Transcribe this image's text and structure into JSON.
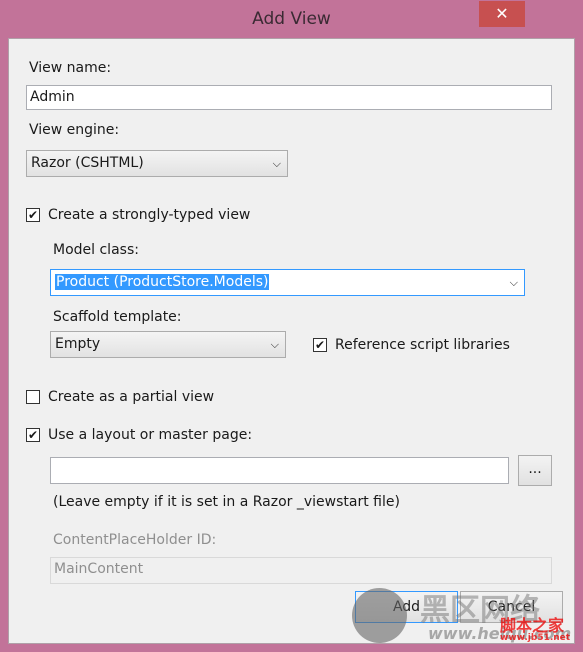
{
  "window": {
    "title": "Add View",
    "close_icon": "close-icon"
  },
  "view_name": {
    "label": "View name:",
    "value": "Admin"
  },
  "view_engine": {
    "label": "View engine:",
    "selected": "Razor (CSHTML)"
  },
  "strongly_typed": {
    "label": "Create a strongly-typed view",
    "checked": true
  },
  "model_class": {
    "label": "Model class:",
    "selected": "Product (ProductStore.Models)"
  },
  "scaffold": {
    "label": "Scaffold template:",
    "selected": "Empty"
  },
  "reference_scripts": {
    "label": "Reference script libraries",
    "checked": true
  },
  "partial_view": {
    "label": "Create as a partial view",
    "checked": false
  },
  "use_layout": {
    "label": "Use a layout or master page:",
    "checked": true,
    "value": "",
    "browse_label": "..."
  },
  "hint": "(Leave empty if it is set in a Razor _viewstart file)",
  "placeholder_id": {
    "label": "ContentPlaceHolder ID:",
    "value": "MainContent"
  },
  "buttons": {
    "add": "Add",
    "cancel": "Cancel"
  },
  "watermark": {
    "cn1": "黑区网络",
    "url1": "www.heiqu.com",
    "cn2": "脚本之家",
    "url2": "www.jb51.net"
  }
}
